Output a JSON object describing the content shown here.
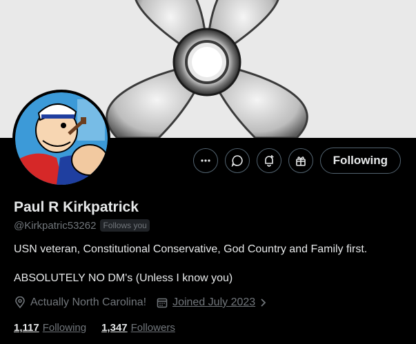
{
  "profile": {
    "name": "Paul R Kirkpatrick",
    "handle": "@Kirkpatric53262",
    "follows_you": "Follows you",
    "bio_line1": "USN veteran, Constitutional Conservative, God Country and Family first.",
    "bio_line2": "ABSOLUTELY NO DM's (Unless I know you)",
    "location": "Actually North Carolina!",
    "joined": "Joined July 2023",
    "following_count": "1,117",
    "following_label": "Following",
    "followers_count": "1,347",
    "followers_label": "Followers"
  },
  "actions": {
    "following_button": "Following",
    "icons": [
      "more-icon",
      "message-icon",
      "notification-bell-icon",
      "gift-icon"
    ]
  },
  "colors": {
    "background": "#000000",
    "text_primary": "#e7e9ea",
    "text_secondary": "#71767b",
    "border": "#536471"
  }
}
